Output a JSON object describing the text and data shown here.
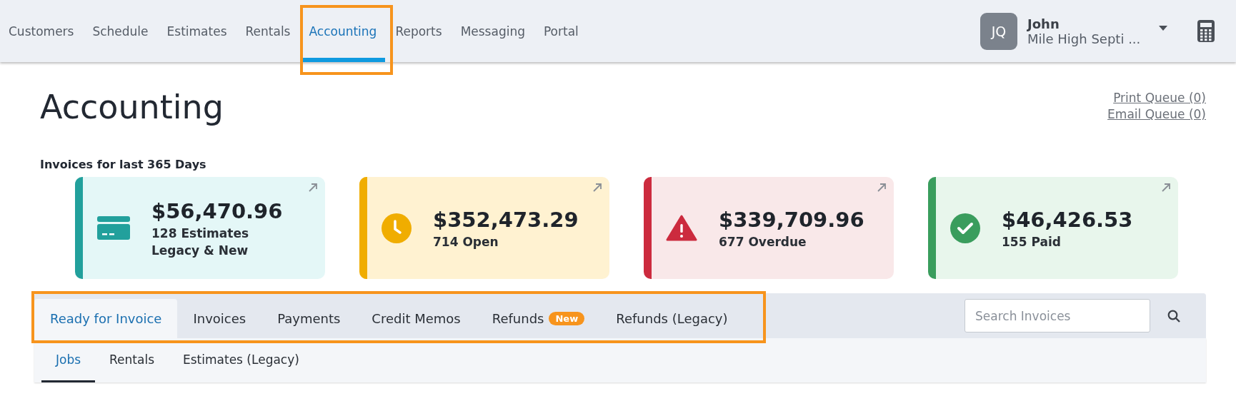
{
  "nav": {
    "items": [
      {
        "label": "Customers",
        "selected": false
      },
      {
        "label": "Schedule",
        "selected": false
      },
      {
        "label": "Estimates",
        "selected": false
      },
      {
        "label": "Rentals",
        "selected": false
      },
      {
        "label": "Accounting",
        "selected": true
      },
      {
        "label": "Reports",
        "selected": false
      },
      {
        "label": "Messaging",
        "selected": false
      },
      {
        "label": "Portal",
        "selected": false
      }
    ],
    "user": {
      "initials": "JQ",
      "name": "John",
      "company": "Mile High Septi ..."
    }
  },
  "page": {
    "title": "Accounting",
    "links": [
      "Print Queue (0)",
      "Email Queue (0)"
    ]
  },
  "summary": {
    "heading": "Invoices for last 365 Days",
    "cards": [
      {
        "kind": "estimates",
        "color": "#22a09c",
        "amount": "$56,470.96",
        "lines": [
          "128 Estimates",
          "Legacy & New"
        ]
      },
      {
        "kind": "open",
        "color": "#f0ad00",
        "amount": "$352,473.29",
        "lines": [
          "714 Open"
        ]
      },
      {
        "kind": "overdue",
        "color": "#cc2b3e",
        "amount": "$339,709.96",
        "lines": [
          "677 Overdue"
        ]
      },
      {
        "kind": "paid",
        "color": "#3a9d5d",
        "amount": "$46,426.53",
        "lines": [
          "155 Paid"
        ]
      }
    ]
  },
  "tabs": [
    {
      "label": "Ready for Invoice",
      "selected": true
    },
    {
      "label": "Invoices",
      "selected": false
    },
    {
      "label": "Payments",
      "selected": false
    },
    {
      "label": "Credit Memos",
      "selected": false
    },
    {
      "label": "Refunds",
      "selected": false,
      "badge": "New"
    },
    {
      "label": "Refunds (Legacy)",
      "selected": false
    }
  ],
  "search": {
    "placeholder": "Search Invoices"
  },
  "subtabs": [
    {
      "label": "Jobs",
      "selected": true
    },
    {
      "label": "Rentals",
      "selected": false
    },
    {
      "label": "Estimates (Legacy)",
      "selected": false
    }
  ]
}
